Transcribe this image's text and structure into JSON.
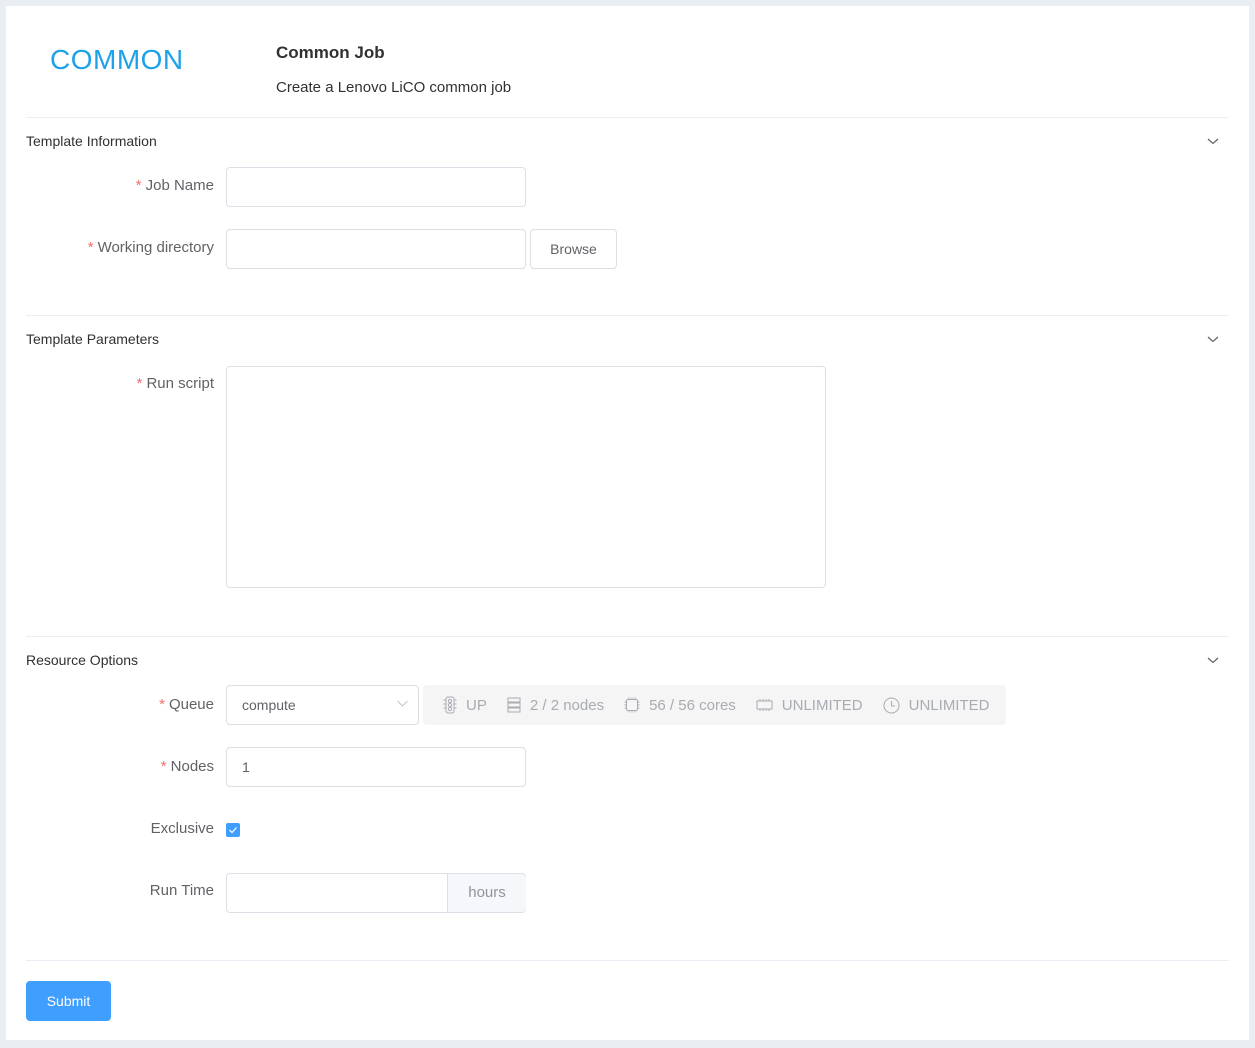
{
  "header": {
    "logo_text": "COMMON",
    "title": "Common Job",
    "subtitle": "Create a Lenovo LiCO common job"
  },
  "sections": {
    "template_information": {
      "title": "Template Information",
      "job_name": {
        "label": "Job Name",
        "required": "*",
        "value": "",
        "placeholder": ""
      },
      "working_directory": {
        "label": "Working directory",
        "required": "*",
        "value": "",
        "placeholder": "",
        "browse_label": "Browse"
      }
    },
    "template_parameters": {
      "title": "Template Parameters",
      "run_script": {
        "label": "Run script",
        "required": "*",
        "value": ""
      }
    },
    "resource_options": {
      "title": "Resource Options",
      "queue": {
        "label": "Queue",
        "required": "*",
        "value": "compute",
        "info": {
          "state": "UP",
          "nodes": "2 / 2 nodes",
          "cores": "56 / 56 cores",
          "memory": "UNLIMITED",
          "time": "UNLIMITED"
        }
      },
      "nodes": {
        "label": "Nodes",
        "required": "*",
        "value": "1"
      },
      "exclusive": {
        "label": "Exclusive",
        "checked": true
      },
      "run_time": {
        "label": "Run Time",
        "value": "",
        "unit": "hours"
      }
    }
  },
  "footer": {
    "submit_label": "Submit"
  },
  "colors": {
    "accent": "#409eff",
    "logo": "#1da1e8",
    "required": "#f56c6c"
  }
}
